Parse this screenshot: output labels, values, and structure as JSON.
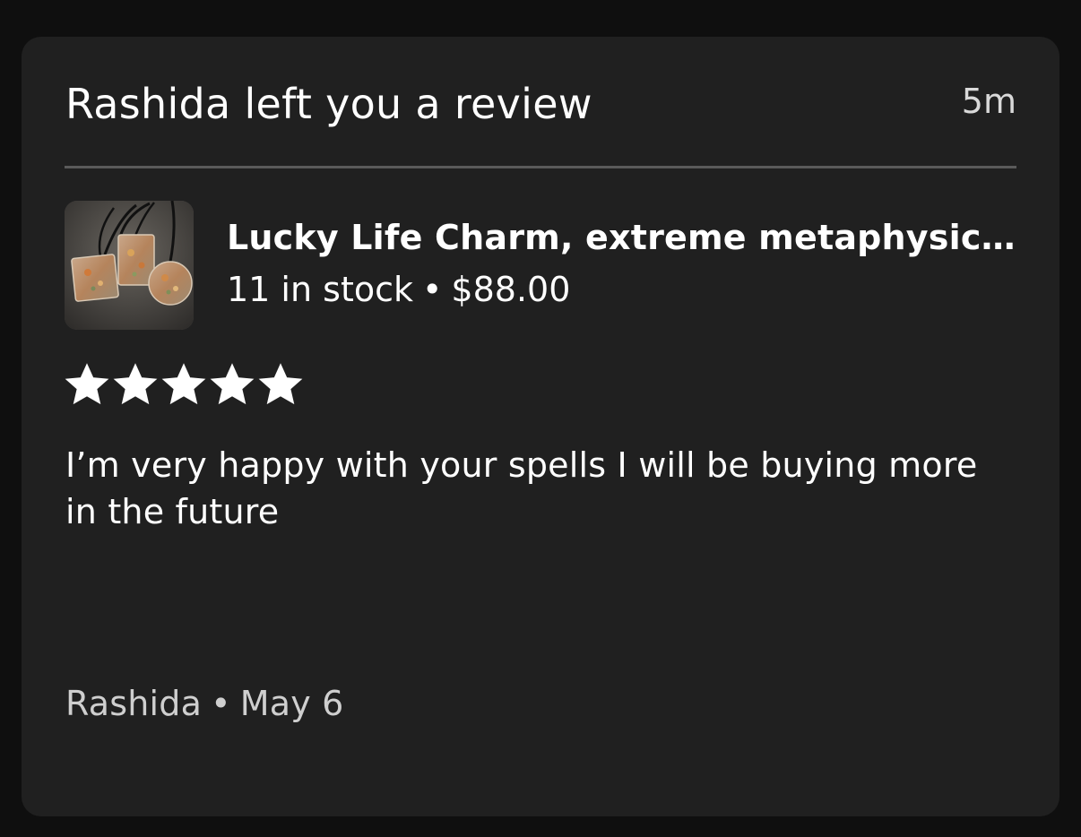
{
  "notification": {
    "title": "Rashida left you a review",
    "time_ago": "5m"
  },
  "product": {
    "name": "Lucky Life Charm, extreme metaphysic...",
    "stock": "11 in stock",
    "separator": "•",
    "price": "$88.00",
    "thumbnail_icon": "product-photo"
  },
  "rating": {
    "value": 5,
    "max": 5,
    "star_color": "#ffffff"
  },
  "review": {
    "text": "I’m very happy with your spells I will be buying more in the future"
  },
  "footer": {
    "author": "Rashida",
    "separator": "•",
    "date": "May 6"
  },
  "colors": {
    "background": "#0f0f0f",
    "card": "#202020",
    "divider": "#5a5a5a",
    "secondary_text": "#cfcfcf"
  }
}
